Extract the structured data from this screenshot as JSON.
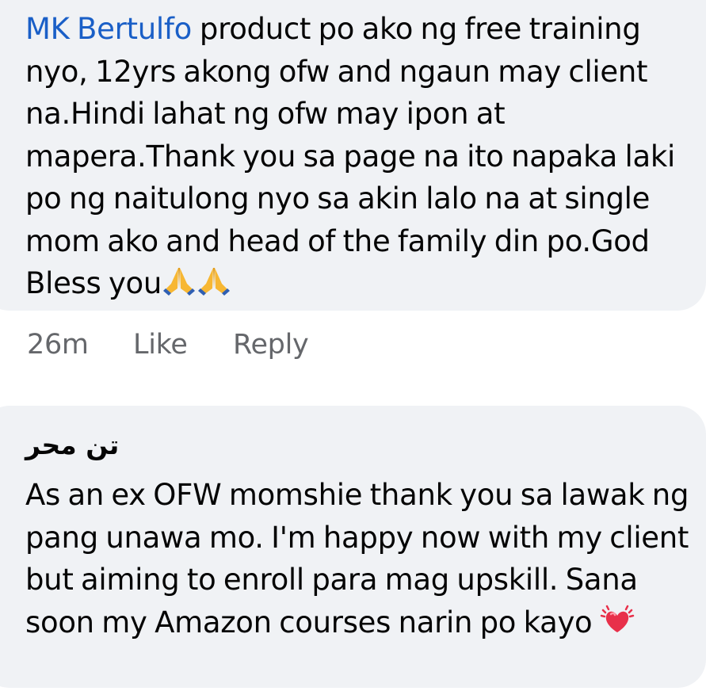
{
  "comments": [
    {
      "author": "MK Bertulfo",
      "text": "product po ako ng free training nyo, 12yrs akong ofw and ngaun may client na.Hindi lahat ng ofw may ipon at mapera.Thank you sa page na ito napaka laki po ng naitulong nyo sa akin lalo na at single mom ako and head of the family din po.God Bless you",
      "emoji": [
        "folded-hands",
        "folded-hands"
      ],
      "timestamp": "26m",
      "like_label": "Like",
      "reply_label": "Reply"
    },
    {
      "author": "تن محر",
      "text": "As an ex OFW momshie thank you sa lawak ng pang unawa mo. I'm happy now with my client but aiming to enroll para mag upskill. Sana soon my Amazon courses narin po kayo",
      "emoji": [
        "beating-heart"
      ]
    }
  ],
  "colors": {
    "bubble": "#f0f2f5",
    "author_link": "#1a5fc7",
    "meta_text": "#65676b",
    "text": "#050505"
  }
}
